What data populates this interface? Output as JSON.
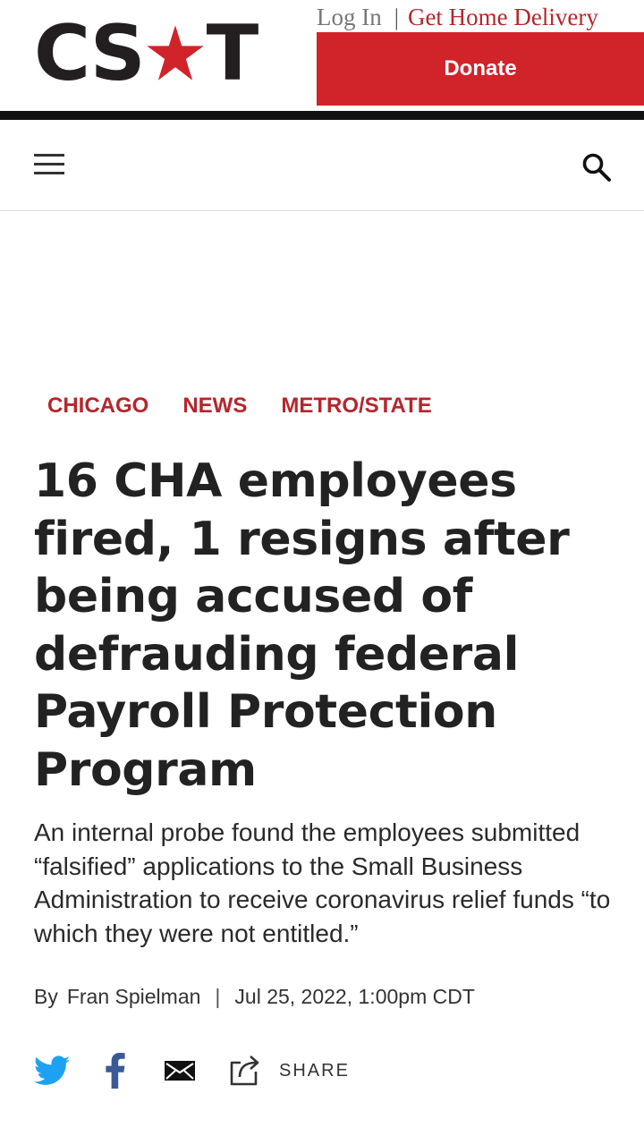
{
  "brand": {
    "logo_left": "CS",
    "logo_right": "T",
    "star_color": "#d1232a"
  },
  "toplinks": {
    "login": "Log In",
    "separator": "|",
    "home_delivery": "Get Home Delivery"
  },
  "donate": {
    "label": "Donate",
    "color": "#d1232a"
  },
  "nav": {
    "menu_icon": "hamburger-menu-icon",
    "search_icon": "search-icon"
  },
  "article": {
    "categories": [
      "CHICAGO",
      "NEWS",
      "METRO/STATE"
    ],
    "headline": "16 CHA employees fired, 1 resigns after being accused of defrauding federal Payroll Protection Program",
    "dek": "An internal probe found the employees submitted “falsified” applications to the Small Business Administration to receive coronavirus relief funds “to which they were not entitled.”",
    "byline_prefix": "By",
    "author": "Fran Spielman",
    "byline_separator": "|",
    "date": "Jul 25, 2022, 1:00pm CDT"
  },
  "share": {
    "label": "SHARE",
    "icons": [
      "twitter-icon",
      "facebook-icon",
      "email-icon",
      "share-icon"
    ],
    "twitter_color": "#1da1f2",
    "facebook_color": "#3b5998"
  }
}
